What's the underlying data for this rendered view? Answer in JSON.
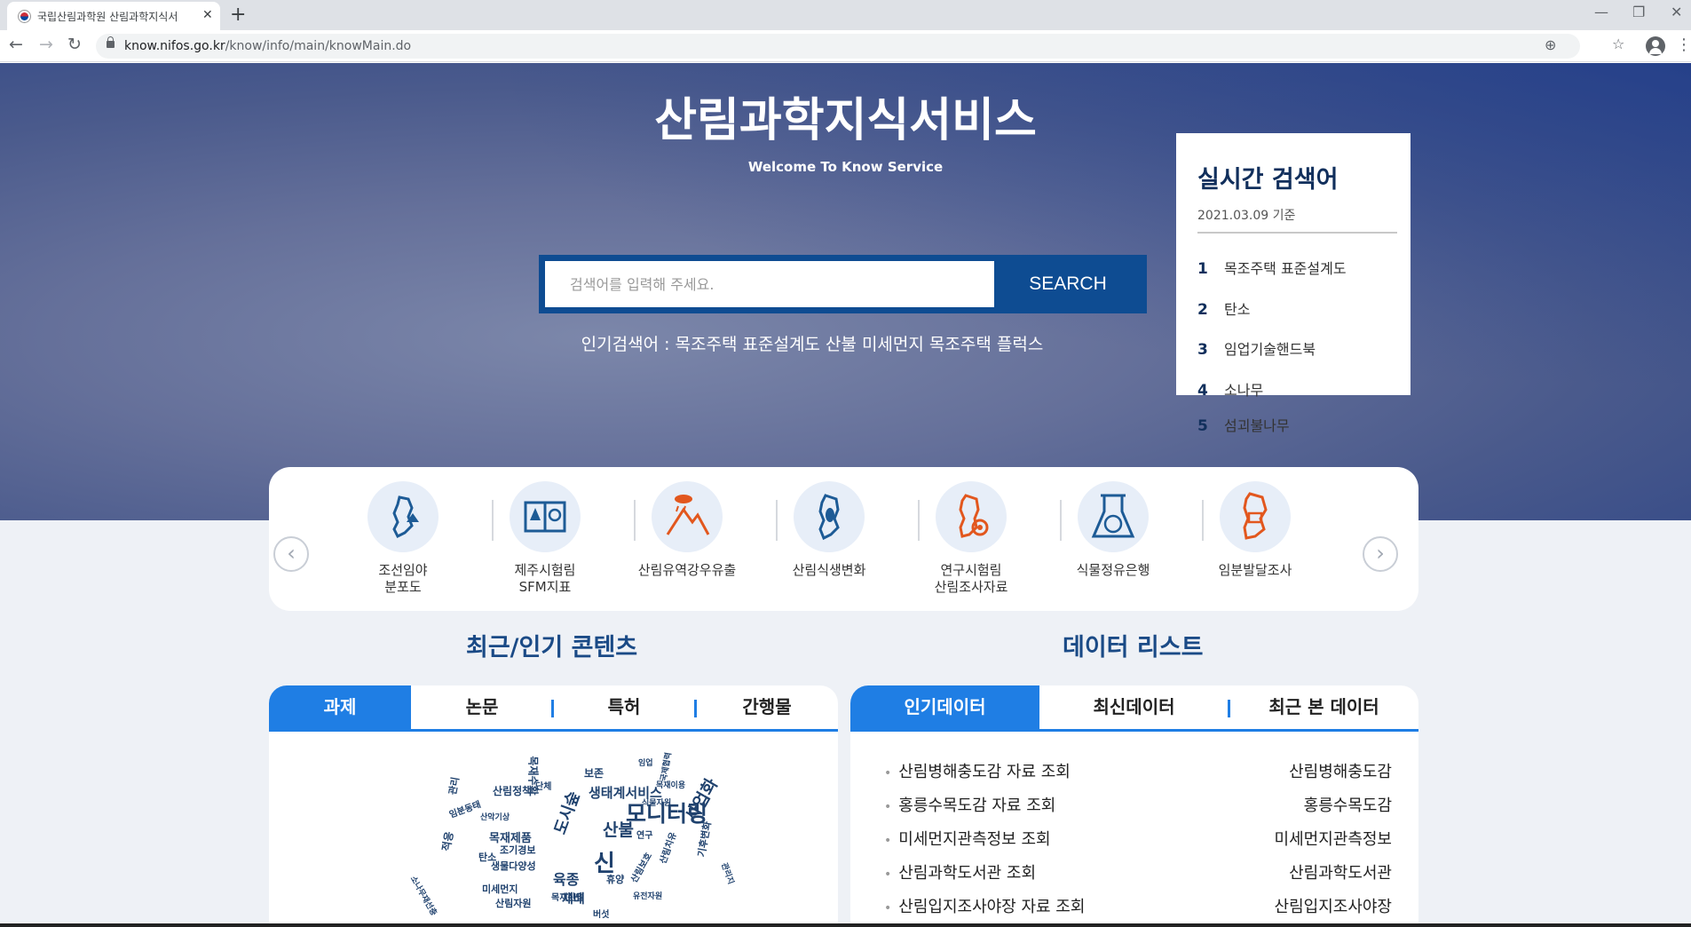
{
  "browser": {
    "tab_title": "국립산림과학원 산림과학지식서",
    "url_host": "know.nifos.go.kr",
    "url_path": "/know/info/main/knowMain.do"
  },
  "hero": {
    "title": "산림과학지식서비스",
    "subtitle": "Welcome To Know Service",
    "search_placeholder": "검색어를 입력해 주세요.",
    "search_button": "SEARCH",
    "popular_text": "인기검색어 : 목조주택 표준설계도 산불 미세먼지 목조주택 플럭스"
  },
  "realtime": {
    "title": "실시간 검색어",
    "date": "2021.03.09 기준",
    "items": [
      {
        "rank": "1",
        "term": "목조주택 표준설계도"
      },
      {
        "rank": "2",
        "term": "탄소"
      },
      {
        "rank": "3",
        "term": "임업기술핸드북"
      },
      {
        "rank": "4",
        "term": "소나무"
      },
      {
        "rank": "5",
        "term": "섬괴불나무"
      }
    ]
  },
  "quick_links": [
    {
      "label": "조선임야\n분포도",
      "icon": "korea-map-forest-icon"
    },
    {
      "label": "제주시험림\nSFM지표",
      "icon": "tree-frame-icon"
    },
    {
      "label": "산림유역강우유출",
      "icon": "rain-mountain-icon"
    },
    {
      "label": "산림식생변화",
      "icon": "korea-map-leaf-icon"
    },
    {
      "label": "연구시험림\n산림조사자료",
      "icon": "korea-map-search-icon"
    },
    {
      "label": "식물정유은행",
      "icon": "flask-leaf-icon"
    },
    {
      "label": "임분발달조사",
      "icon": "korea-map-chart-icon"
    }
  ],
  "content_section": {
    "title": "최근/인기 콘텐츠",
    "tabs": [
      "과제",
      "논문",
      "특허",
      "간행물"
    ],
    "cloud_words": [
      "모니터링",
      "산불",
      "신",
      "목재제품",
      "산림정책",
      "도시숲",
      "생물다양성",
      "미세먼지",
      "관리",
      "임분동태",
      "적응",
      "조기경보",
      "육종",
      "재배",
      "목재수확",
      "목재산업",
      "산림치유",
      "산악기상",
      "생태계서비스",
      "보존",
      "사업화",
      "기후변화",
      "국제협력",
      "연구",
      "임업",
      "소나무재선충",
      "식물자원",
      "산림자원",
      "휴양",
      "단체",
      "목재이용",
      "관리지",
      "산림보호",
      "유전자원",
      "탄소",
      "버섯"
    ]
  },
  "data_section": {
    "title": "데이터 리스트",
    "tabs": [
      "인기데이터",
      "최신데이터",
      "최근 본 데이터"
    ],
    "items": [
      {
        "left": "산림병해충도감 자료 조회",
        "right": "산림병해충도감"
      },
      {
        "left": "홍릉수목도감 자료 조회",
        "right": "홍릉수목도감"
      },
      {
        "left": "미세먼지관측정보 조회",
        "right": "미세먼지관측정보"
      },
      {
        "left": "산림과학도서관 조회",
        "right": "산림과학도서관"
      },
      {
        "left": "산림입지조사야장 자료 조회",
        "right": "산림입지조사야장"
      }
    ]
  }
}
